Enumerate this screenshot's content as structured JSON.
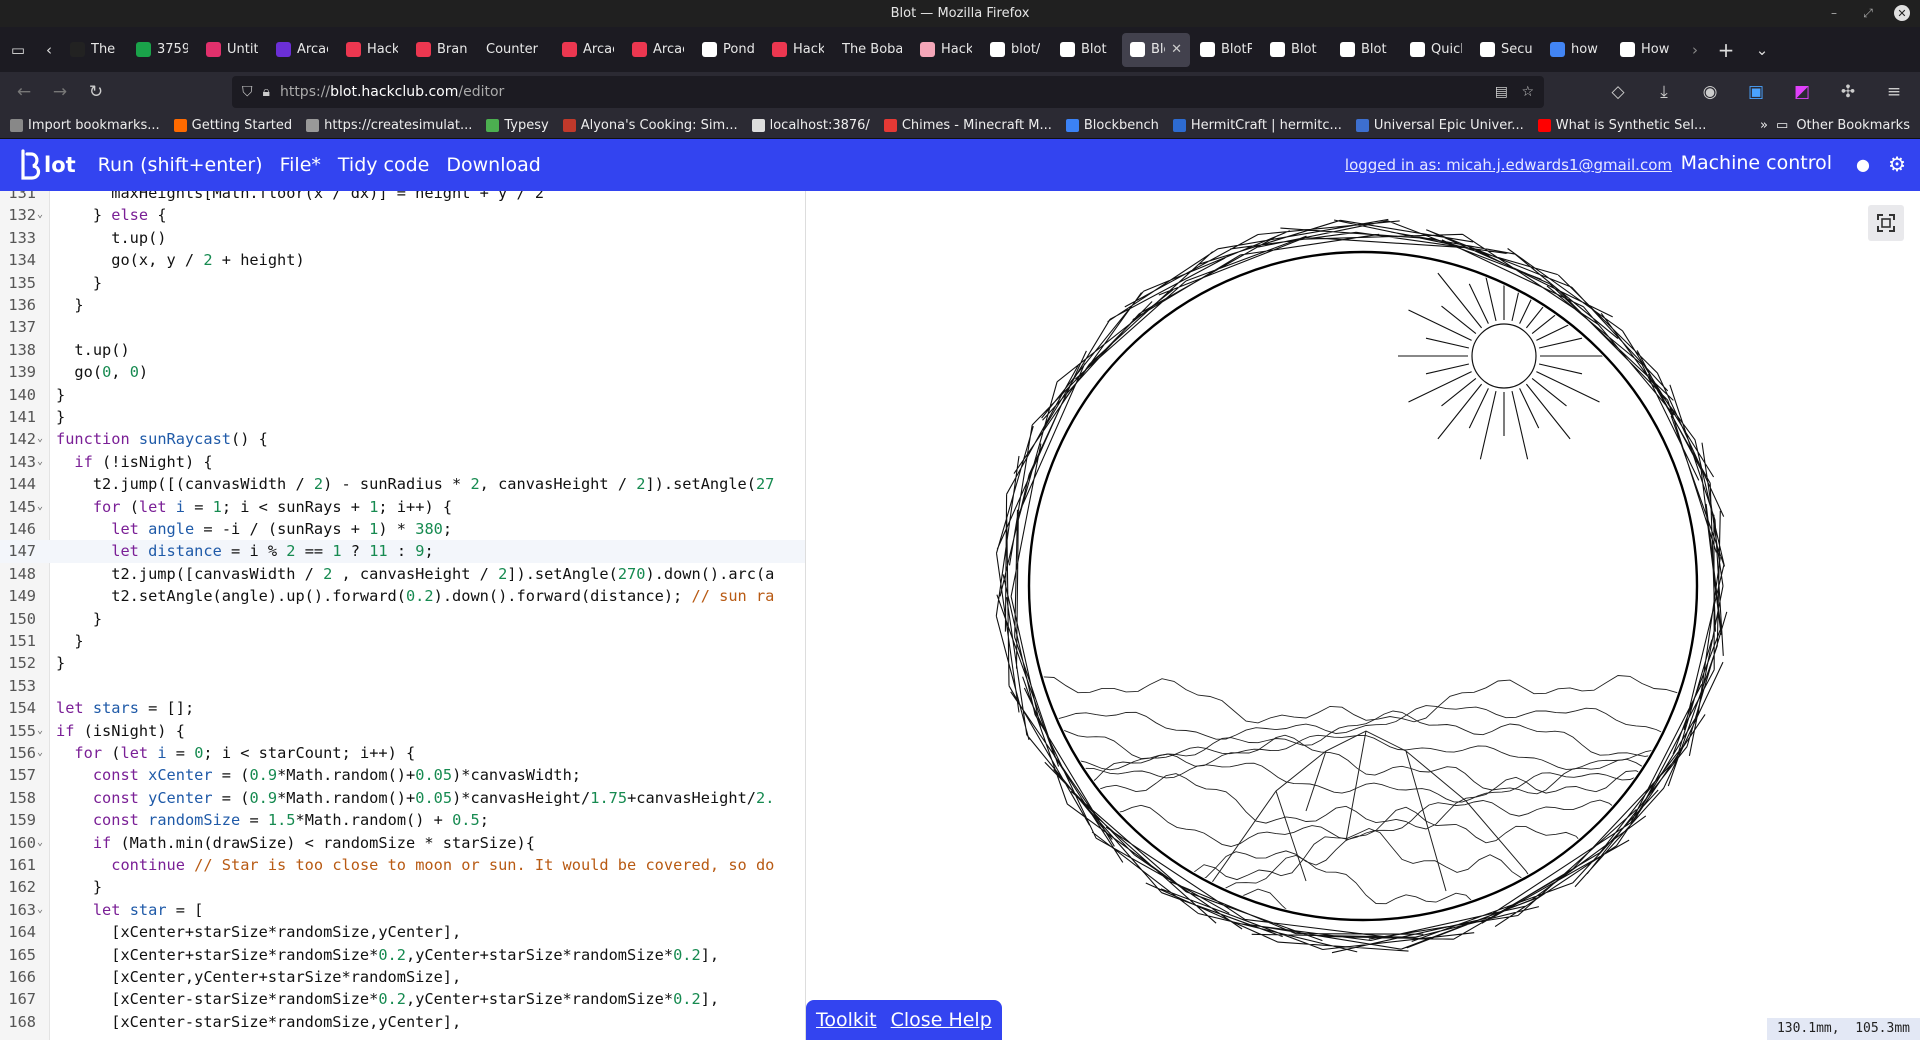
{
  "window": {
    "title": "Blot — Mozilla Firefox"
  },
  "tabs": [
    {
      "label": "The B",
      "color": "#222"
    },
    {
      "label": "3759",
      "color": "#1aa34a"
    },
    {
      "label": "Untit",
      "color": "#e1306c"
    },
    {
      "label": "Arcac",
      "color": "#6b2fd6"
    },
    {
      "label": "Hack",
      "color": "#ec3750"
    },
    {
      "label": "Branc",
      "color": "#ec3750"
    },
    {
      "label": "Counter",
      "color": ""
    },
    {
      "label": "Arcac",
      "color": "#ec3750"
    },
    {
      "label": "Arcac",
      "color": "#ec3750"
    },
    {
      "label": "Pond",
      "color": "#fff"
    },
    {
      "label": "Hack",
      "color": "#ec3750"
    },
    {
      "label": "The Boba",
      "color": ""
    },
    {
      "label": "Hack",
      "color": "#f4a6b8"
    },
    {
      "label": "blot/",
      "color": "#fff"
    },
    {
      "label": "Blot",
      "color": "#fff"
    },
    {
      "label": "Blo",
      "color": "#fff",
      "active": true
    },
    {
      "label": "BlotP",
      "color": "#fff"
    },
    {
      "label": "Blot",
      "color": "#fff"
    },
    {
      "label": "Blot",
      "color": "#fff"
    },
    {
      "label": "Quick",
      "color": "#fff"
    },
    {
      "label": "Secu",
      "color": "#fff"
    },
    {
      "label": "how t",
      "color": "#4285f4"
    },
    {
      "label": "How",
      "color": "#fff"
    }
  ],
  "url": {
    "prefix": "https://",
    "host": "blot.hackclub.com",
    "path": "/editor"
  },
  "bookmarks": [
    {
      "label": "Import bookmarks...",
      "color": "#888"
    },
    {
      "label": "Getting Started",
      "color": "#ff6a00"
    },
    {
      "label": "https://createsimulat...",
      "color": "#999"
    },
    {
      "label": "Typesy",
      "color": "#4caf50"
    },
    {
      "label": "Alyona's Cooking: Sim...",
      "color": "#c0392b"
    },
    {
      "label": "localhost:3876/",
      "color": "#ddd"
    },
    {
      "label": "Chimes - Minecraft M...",
      "color": "#e53935"
    },
    {
      "label": "Blockbench",
      "color": "#3b82f6"
    },
    {
      "label": "HermitCraft | hermitc...",
      "color": "#2d6bd1"
    },
    {
      "label": "Universal Epic Univer...",
      "color": "#3d6fcf"
    },
    {
      "label": "What is Synthetic Sel...",
      "color": "#ff0000"
    }
  ],
  "bookmarks_other": "Other Bookmarks",
  "app": {
    "logo": "lot",
    "run": "Run (shift+enter)",
    "file": "File*",
    "tidy": "Tidy code",
    "download": "Download",
    "login": "logged in as: micah.j.edwards1@gmail.com",
    "machine": "Machine control",
    "accent": "#3344f0"
  },
  "code_lines": [
    {
      "n": "131",
      "fold": "",
      "html": "      maxHeights[Math.floor(x / dx)] = height + y / 2"
    },
    {
      "n": "132",
      "fold": "⌄",
      "html": "    } <span class='k'>else</span> {"
    },
    {
      "n": "133",
      "fold": "",
      "html": "      t.up()"
    },
    {
      "n": "134",
      "fold": "",
      "html": "      go(x, y / <span class='n'>2</span> + height)"
    },
    {
      "n": "135",
      "fold": "",
      "html": "    }"
    },
    {
      "n": "136",
      "fold": "",
      "html": "  }"
    },
    {
      "n": "137",
      "fold": "",
      "html": ""
    },
    {
      "n": "138",
      "fold": "",
      "html": "  t.up()"
    },
    {
      "n": "139",
      "fold": "",
      "html": "  go(<span class='n'>0</span>, <span class='n'>0</span>)"
    },
    {
      "n": "140",
      "fold": "",
      "html": "}"
    },
    {
      "n": "141",
      "fold": "",
      "html": "}"
    },
    {
      "n": "142",
      "fold": "⌄",
      "html": "<span class='k'>function</span> <span class='f'>sunRaycast</span>() {"
    },
    {
      "n": "143",
      "fold": "⌄",
      "html": "  <span class='k'>if</span> (!isNight) {"
    },
    {
      "n": "144",
      "fold": "",
      "html": "    t2.jump([(canvasWidth / <span class='n'>2</span>) - sunRadius * <span class='n'>2</span>, canvasHeight / <span class='n'>2</span>]).setAngle(<span class='n'>27</span>"
    },
    {
      "n": "145",
      "fold": "⌄",
      "html": "    <span class='k'>for</span> (<span class='k'>let</span> <span class='f'>i</span> = <span class='n'>1</span>; i &lt; sunRays + <span class='n'>1</span>; i++) {"
    },
    {
      "n": "146",
      "fold": "",
      "html": "      <span class='k'>let</span> <span class='f'>angle</span> = -i / (sunRays + <span class='n'>1</span>) * <span class='n'>380</span>;"
    },
    {
      "n": "147",
      "fold": "",
      "html": "      <span class='k'>let</span> <span class='f'>distance</span> = i % <span class='n'>2</span> == <span class='n'>1</span> ? <span class='n'>11</span> : <span class='n'>9</span>;",
      "cur": true
    },
    {
      "n": "148",
      "fold": "",
      "html": "      t2.jump([canvasWidth / <span class='n'>2</span> , canvasHeight / <span class='n'>2</span>]).setAngle(<span class='n'>270</span>).down().arc(a"
    },
    {
      "n": "149",
      "fold": "",
      "html": "      t2.setAngle(angle).up().forward(<span class='n'>0.2</span>).down().forward(distance); <span class='c'>// sun ra</span>"
    },
    {
      "n": "150",
      "fold": "",
      "html": "    }"
    },
    {
      "n": "151",
      "fold": "",
      "html": "  }"
    },
    {
      "n": "152",
      "fold": "",
      "html": "}"
    },
    {
      "n": "153",
      "fold": "",
      "html": ""
    },
    {
      "n": "154",
      "fold": "",
      "html": "<span class='k'>let</span> <span class='f'>stars</span> = [];"
    },
    {
      "n": "155",
      "fold": "⌄",
      "html": "<span class='k'>if</span> (isNight) {"
    },
    {
      "n": "156",
      "fold": "⌄",
      "html": "  <span class='k'>for</span> (<span class='k'>let</span> <span class='f'>i</span> = <span class='n'>0</span>; i &lt; starCount; i++) {"
    },
    {
      "n": "157",
      "fold": "",
      "html": "    <span class='k'>const</span> <span class='f'>xCenter</span> = (<span class='n'>0.9</span>*Math.random()+<span class='n'>0.05</span>)*canvasWidth;"
    },
    {
      "n": "158",
      "fold": "",
      "html": "    <span class='k'>const</span> <span class='f'>yCenter</span> = (<span class='n'>0.9</span>*Math.random()+<span class='n'>0.05</span>)*canvasHeight/<span class='n'>1.75</span>+canvasHeight/<span class='n'>2.</span>"
    },
    {
      "n": "159",
      "fold": "",
      "html": "    <span class='k'>const</span> <span class='f'>randomSize</span> = <span class='n'>1.5</span>*Math.random() + <span class='n'>0.5</span>;"
    },
    {
      "n": "160",
      "fold": "⌄",
      "html": "    <span class='k'>if</span> (Math.min(drawSize) &lt; randomSize * starSize){"
    },
    {
      "n": "161",
      "fold": "",
      "html": "      <span class='k'>continue</span> <span class='c'>// Star is too close to moon or sun. It would be covered, so do</span>"
    },
    {
      "n": "162",
      "fold": "",
      "html": "    }"
    },
    {
      "n": "163",
      "fold": "⌄",
      "html": "    <span class='k'>let</span> <span class='f'>star</span> = ["
    },
    {
      "n": "164",
      "fold": "",
      "html": "      [xCenter+starSize*randomSize,yCenter],"
    },
    {
      "n": "165",
      "fold": "",
      "html": "      [xCenter+starSize*randomSize*<span class='n'>0.2</span>,yCenter+starSize*randomSize*<span class='n'>0.2</span>],"
    },
    {
      "n": "166",
      "fold": "",
      "html": "      [xCenter,yCenter+starSize*randomSize],"
    },
    {
      "n": "167",
      "fold": "",
      "html": "      [xCenter-starSize*randomSize*<span class='n'>0.2</span>,yCenter+starSize*randomSize*<span class='n'>0.2</span>],"
    },
    {
      "n": "168",
      "fold": "",
      "html": "      [xCenter-starSize*randomSize,yCenter],"
    }
  ],
  "help": {
    "toolkit": "Toolkit",
    "close": "Close Help"
  },
  "coords": "130.1mm,  105.3mm"
}
